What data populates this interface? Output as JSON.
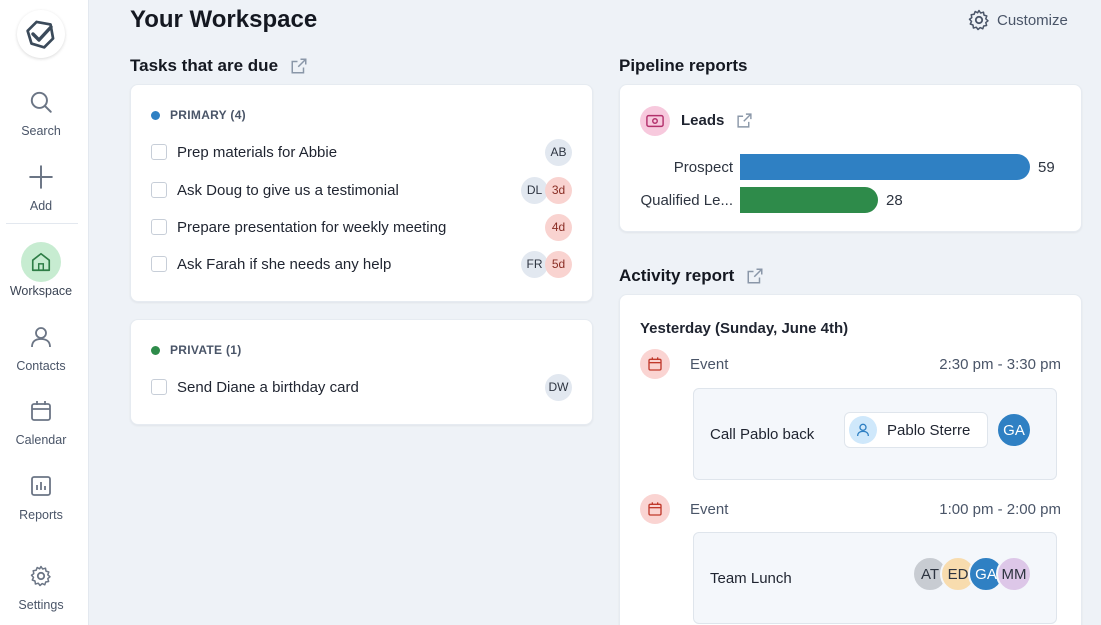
{
  "sidebar": {
    "items": [
      {
        "label": "Search",
        "icon": "search-icon"
      },
      {
        "label": "Add",
        "icon": "plus-icon"
      },
      {
        "label": "Workspace",
        "icon": "home-icon",
        "active": true
      },
      {
        "label": "Contacts",
        "icon": "person-icon"
      },
      {
        "label": "Calendar",
        "icon": "calendar-icon"
      },
      {
        "label": "Reports",
        "icon": "bar-chart-icon"
      },
      {
        "label": "Settings",
        "icon": "gear-icon"
      }
    ]
  },
  "header": {
    "title": "Your Workspace",
    "customize_label": "Customize"
  },
  "tasks": {
    "title": "Tasks that are due",
    "primary": {
      "label": "PRIMARY (4)",
      "color": "#2f80c3",
      "items": [
        {
          "text": "Prep materials for Abbie",
          "assignee": "AB",
          "due": ""
        },
        {
          "text": "Ask Doug to give us a testimonial",
          "assignee": "DL",
          "due": "3d"
        },
        {
          "text": "Prepare presentation for weekly meeting",
          "assignee": "",
          "due": "4d"
        },
        {
          "text": "Ask Farah if she needs any help",
          "assignee": "FR",
          "due": "5d"
        }
      ]
    },
    "private": {
      "label": "PRIVATE (1)",
      "color": "#2e8b4a",
      "items": [
        {
          "text": "Send Diane a birthday card",
          "assignee": "DW",
          "due": ""
        }
      ]
    }
  },
  "pipeline": {
    "title": "Pipeline reports",
    "card_title": "Leads",
    "bars": [
      {
        "label": "Prospect",
        "value": 59,
        "color": "#2f80c3"
      },
      {
        "label": "Qualified Le...",
        "value": 28,
        "color": "#2e8b4a"
      }
    ]
  },
  "activity": {
    "title": "Activity report",
    "day": "Yesterday (Sunday, June 4th)",
    "events": [
      {
        "type": "Event",
        "time": "2:30 pm - 3:30 pm",
        "name": "Call Pablo back",
        "contact": "Pablo Sterre",
        "attendees": [
          {
            "initials": "GA",
            "color": "#2f80c3",
            "text_color": "#ffffff"
          }
        ]
      },
      {
        "type": "Event",
        "time": "1:00 pm - 2:00 pm",
        "name": "Team Lunch",
        "contact": "",
        "attendees": [
          {
            "initials": "AT",
            "color": "#c8ccd2",
            "text_color": "#2d3440"
          },
          {
            "initials": "ED",
            "color": "#f8dcae",
            "text_color": "#2d3440"
          },
          {
            "initials": "GA",
            "color": "#2f80c3",
            "text_color": "#ffffff"
          },
          {
            "initials": "MM",
            "color": "#ddc7e8",
            "text_color": "#2d3440"
          }
        ]
      }
    ]
  }
}
